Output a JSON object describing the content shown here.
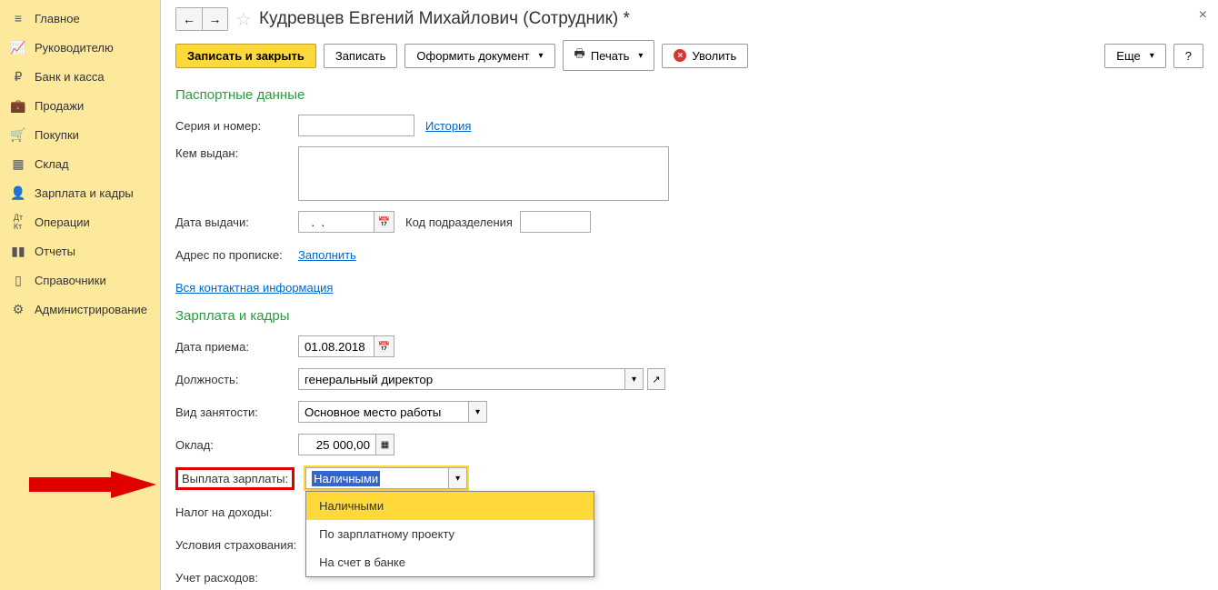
{
  "sidebar": {
    "items": [
      {
        "label": "Главное",
        "icon": "menu"
      },
      {
        "label": "Руководителю",
        "icon": "chart"
      },
      {
        "label": "Банк и касса",
        "icon": "ruble"
      },
      {
        "label": "Продажи",
        "icon": "briefcase"
      },
      {
        "label": "Покупки",
        "icon": "cart"
      },
      {
        "label": "Склад",
        "icon": "boxes"
      },
      {
        "label": "Зарплата и кадры",
        "icon": "person"
      },
      {
        "label": "Операции",
        "icon": "dk"
      },
      {
        "label": "Отчеты",
        "icon": "bars"
      },
      {
        "label": "Справочники",
        "icon": "book"
      },
      {
        "label": "Администрирование",
        "icon": "gear"
      }
    ]
  },
  "header": {
    "title": "Кудревцев Евгений Михайлович (Сотрудник) *"
  },
  "toolbar": {
    "save_close": "Записать и закрыть",
    "save": "Записать",
    "create_doc": "Оформить документ",
    "print": "Печать",
    "fire": "Уволить",
    "more": "Еще",
    "help": "?"
  },
  "sections": {
    "passport": "Паспортные данные",
    "payroll": "Зарплата и кадры"
  },
  "fields": {
    "serial_label": "Серия и номер:",
    "serial_value": "",
    "history_link": "История",
    "issued_by_label": "Кем выдан:",
    "issued_by_value": "",
    "issue_date_label": "Дата выдачи:",
    "issue_date_value": "  .  .    ",
    "dept_code_label": "Код подразделения",
    "dept_code_value": "",
    "reg_addr_label": "Адрес по прописке:",
    "fill_link": "Заполнить",
    "all_contacts_link": "Вся контактная информация",
    "hire_date_label": "Дата приема:",
    "hire_date_value": "01.08.2018",
    "position_label": "Должность:",
    "position_value": "генеральный директор",
    "employment_label": "Вид занятости:",
    "employment_value": "Основное место работы",
    "salary_label": "Оклад:",
    "salary_value": "25 000,00",
    "payout_label": "Выплата зарплаты:",
    "payout_value": "Наличными",
    "tax_label": "Налог на доходы:",
    "insurance_label": "Условия страхования:",
    "expenses_label": "Учет расходов:"
  },
  "dropdown": {
    "items": [
      "Наличными",
      "По зарплатному проекту",
      "На счет в банке"
    ],
    "selected_index": 0
  }
}
